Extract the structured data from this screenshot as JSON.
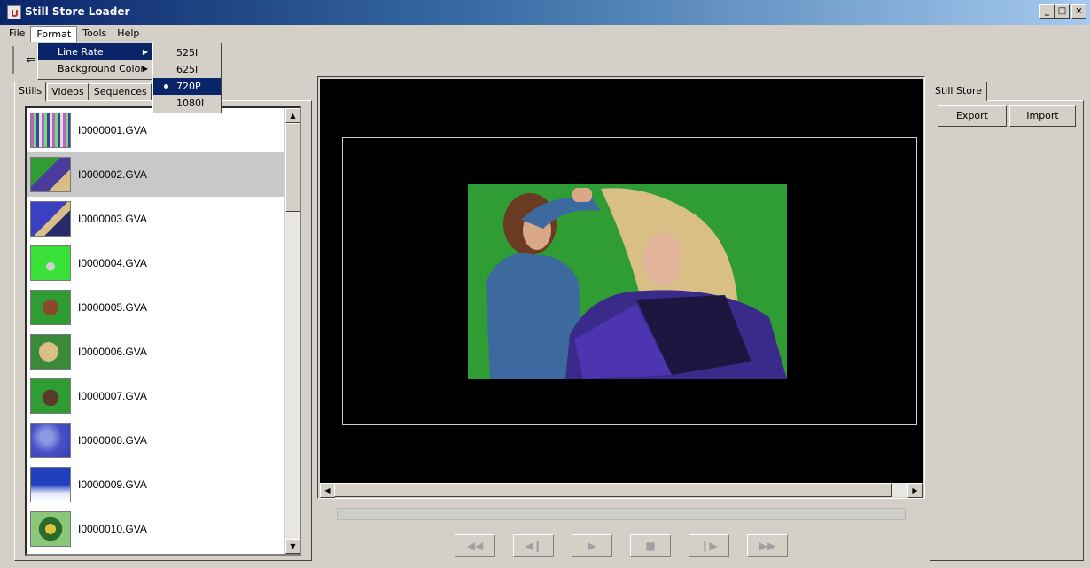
{
  "window": {
    "title": "Still Store Loader",
    "minimize": "_",
    "maximize": "□",
    "close": "×"
  },
  "menubar": {
    "items": [
      "File",
      "Format",
      "Tools",
      "Help"
    ],
    "open_menu": "Format"
  },
  "format_menu": {
    "items": [
      {
        "label": "Line Rate",
        "has_submenu": true,
        "highlighted": true
      },
      {
        "label": "Background Color",
        "has_submenu": true,
        "highlighted": false
      }
    ],
    "submenu_arrow": "▶"
  },
  "line_rate_submenu": {
    "options": [
      "525I",
      "625I",
      "720P",
      "1080I"
    ],
    "selected": "720P"
  },
  "toolbar": {
    "back_icon": "⇐"
  },
  "left_tabs": [
    "Stills",
    "Videos",
    "Sequences"
  ],
  "left_active_tab": "Stills",
  "stills": [
    {
      "name": "I0000001.GVA",
      "selected": false
    },
    {
      "name": "I0000002.GVA",
      "selected": true
    },
    {
      "name": "I0000003.GVA",
      "selected": false
    },
    {
      "name": "I0000004.GVA",
      "selected": false
    },
    {
      "name": "I0000005.GVA",
      "selected": false
    },
    {
      "name": "I0000006.GVA",
      "selected": false
    },
    {
      "name": "I0000007.GVA",
      "selected": false
    },
    {
      "name": "I0000008.GVA",
      "selected": false
    },
    {
      "name": "I0000009.GVA",
      "selected": false
    },
    {
      "name": "I0000010.GVA",
      "selected": false
    }
  ],
  "scroll": {
    "up": "▲",
    "down": "▼",
    "left": "◀",
    "right": "▶"
  },
  "transport": {
    "buttons": [
      {
        "name": "rewind",
        "icon": "◀◀"
      },
      {
        "name": "step-back",
        "icon": "◀❙"
      },
      {
        "name": "play",
        "icon": "▶"
      },
      {
        "name": "stop",
        "icon": "■"
      },
      {
        "name": "step-forward",
        "icon": "❙▶"
      },
      {
        "name": "fast-forward",
        "icon": "▶▶"
      }
    ],
    "progress": 0
  },
  "right_panel": {
    "tab": "Still Store",
    "export_label": "Export",
    "import_label": "Import"
  },
  "colors": {
    "title_start": "#0a246a",
    "title_end": "#a6caf0",
    "highlight": "#0a246a",
    "chromakey_green": "#2a9a2e"
  }
}
